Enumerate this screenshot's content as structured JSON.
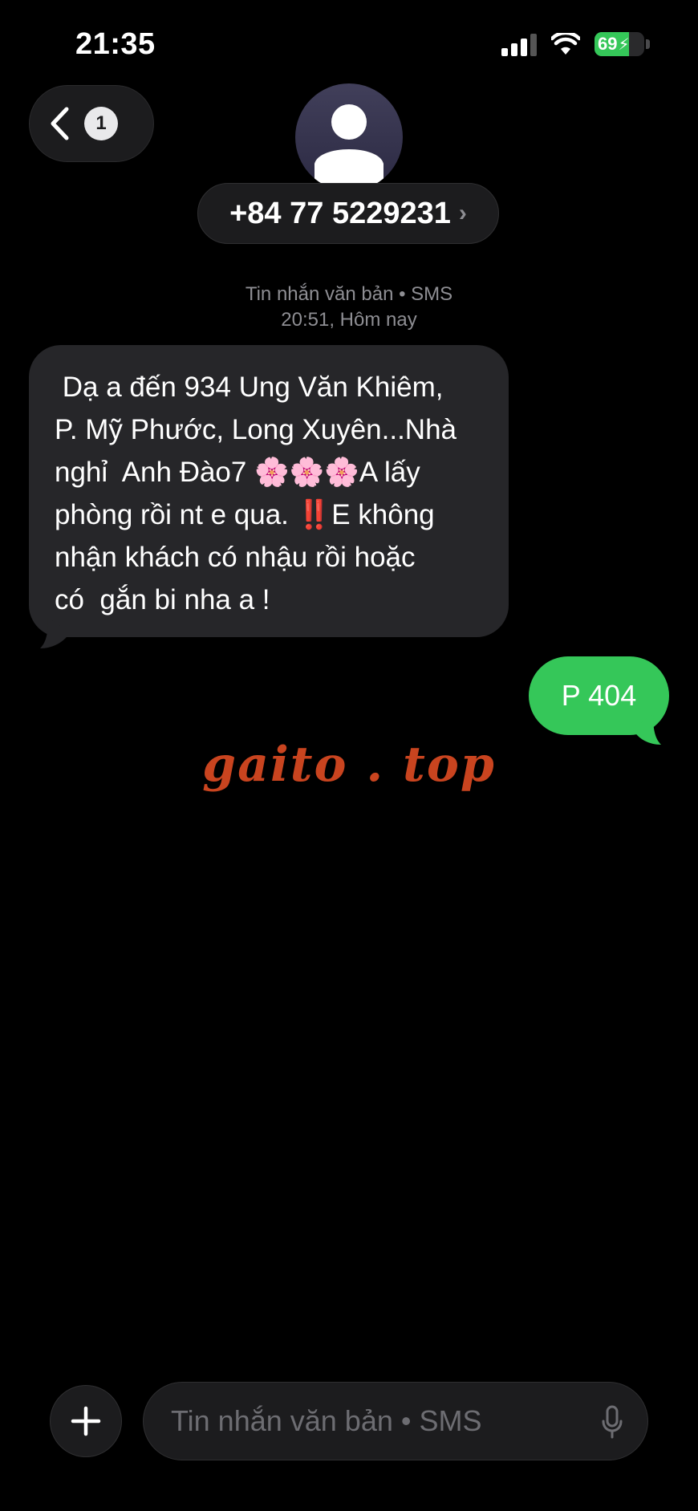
{
  "status_bar": {
    "time": "21:35",
    "battery_percent": "69",
    "battery_level": 0.69,
    "charging": true
  },
  "header": {
    "back": {
      "unread_count": "1"
    },
    "contact": {
      "number": "+84 77 5229231",
      "chevron": "›"
    }
  },
  "conversation": {
    "meta_type": "Tin nhắn văn bản • SMS",
    "meta_time": "20:51, Hôm nay",
    "incoming_text": " Dạ a đến 934 Ung Văn Khiêm,\nP. Mỹ Phước, Long Xuyên...Nhà\nnghỉ  Anh Đào7 🌸🌸🌸A lấy\nphòng rồi nt e qua. ‼️E không\nnhận khách có nhậu rồi hoặc\ncó  gắn bi nha a !",
    "outgoing_text": "P 404"
  },
  "watermark": "gaito . top",
  "composer": {
    "placeholder": "Tin nhắn văn bản • SMS"
  },
  "colors": {
    "background": "#000000",
    "incoming_bubble": "#262629",
    "outgoing_bubble": "#35c759",
    "watermark": "#c9441f",
    "secondary_text": "#8e8e93"
  },
  "icons": [
    "signal-icon",
    "wifi-icon",
    "battery-icon",
    "chevron-left-icon",
    "person-icon",
    "plus-icon",
    "microphone-icon"
  ]
}
